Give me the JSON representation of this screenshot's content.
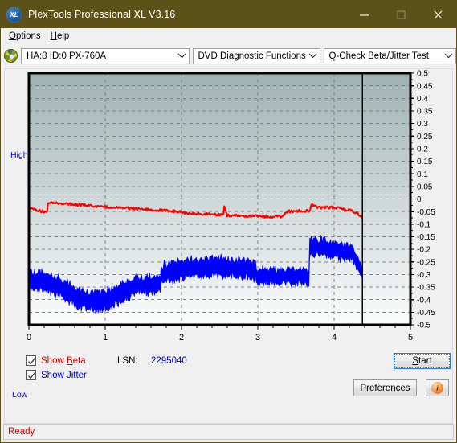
{
  "window": {
    "title": "PlexTools Professional XL V3.16",
    "icon": "xl-logo-icon",
    "logo_text": "XL",
    "minimize_label": "─",
    "maximize_label": "□",
    "close_label": "✕",
    "titlebar_color": "#5c5118"
  },
  "menubar": {
    "items": [
      {
        "label": "Options",
        "accel": "O"
      },
      {
        "label": "Help",
        "accel": "H"
      }
    ]
  },
  "toolbar": {
    "disc_icon": "disc-icon",
    "drive_select": {
      "value": "HA:8 ID:0  PX-760A",
      "options": [
        "HA:8 ID:0  PX-760A"
      ]
    },
    "function_select": {
      "value": "DVD Diagnostic Functions",
      "options": [
        "DVD Diagnostic Functions"
      ]
    },
    "test_select": {
      "value": "Q-Check Beta/Jitter Test",
      "options": [
        "Q-Check Beta/Jitter Test"
      ]
    }
  },
  "chart_labels": {
    "high": "High",
    "low": "Low"
  },
  "controls": {
    "show_beta": {
      "label": "Show Beta",
      "accel": "B",
      "checked": true,
      "color": "#d00000"
    },
    "show_jitter": {
      "label": "Show Jitter",
      "accel": "J",
      "checked": true,
      "color": "#0000d0"
    },
    "lsn_label": "LSN:",
    "lsn_value": "2295040",
    "start_button": {
      "label": "Start",
      "accel": "S",
      "focused": true
    },
    "preferences_button": {
      "label": "Preferences",
      "accel": "P"
    },
    "info_button": {
      "label": "i",
      "icon": "info-icon"
    }
  },
  "statusbar": {
    "text": "Ready",
    "color": "#d00000"
  },
  "chart_data": {
    "type": "line",
    "title": "Q-Check Beta/Jitter Test",
    "xlabel": "",
    "ylabel": "",
    "xlim": [
      0,
      5
    ],
    "ylim": [
      -0.5,
      0.5
    ],
    "xticks": [
      0,
      1,
      2,
      3,
      4,
      5
    ],
    "yticks": [
      0.5,
      0.45,
      0.4,
      0.35,
      0.3,
      0.25,
      0.2,
      0.15,
      0.1,
      0.05,
      0,
      -0.05,
      -0.1,
      -0.15,
      -0.2,
      -0.25,
      -0.3,
      -0.35,
      -0.4,
      -0.45,
      -0.5
    ],
    "grid": true,
    "grid_style": "dashed",
    "grid_color": "#808080",
    "plot_bg_gradient": [
      "#9fb2b3",
      "#fbfcfc"
    ],
    "legend_position": "below-left",
    "data_end_marker_x": 4.37,
    "series": [
      {
        "name": "Beta",
        "color": "#ff0000",
        "label": "Show Beta",
        "x": [
          0.0,
          0.05,
          0.1,
          0.15,
          0.2,
          0.24,
          0.25,
          0.3,
          0.4,
          0.5,
          0.6,
          0.7,
          0.8,
          0.9,
          1.0,
          1.1,
          1.2,
          1.3,
          1.4,
          1.5,
          1.6,
          1.7,
          1.8,
          1.9,
          1.99,
          2.0,
          2.1,
          2.2,
          2.3,
          2.4,
          2.5,
          2.55,
          2.56,
          2.6,
          2.7,
          2.8,
          2.9,
          2.99,
          3.0,
          3.1,
          3.2,
          3.3,
          3.4,
          3.5,
          3.6,
          3.68,
          3.7,
          3.8,
          3.9,
          4.0,
          4.1,
          4.2,
          4.3,
          4.37
        ],
        "y": [
          -0.035,
          -0.04,
          -0.045,
          -0.048,
          -0.05,
          -0.052,
          -0.012,
          -0.014,
          -0.017,
          -0.02,
          -0.022,
          -0.025,
          -0.027,
          -0.029,
          -0.031,
          -0.033,
          -0.035,
          -0.037,
          -0.039,
          -0.041,
          -0.043,
          -0.045,
          -0.047,
          -0.049,
          -0.05,
          -0.056,
          -0.058,
          -0.059,
          -0.06,
          -0.061,
          -0.062,
          -0.062,
          -0.03,
          -0.065,
          -0.066,
          -0.067,
          -0.068,
          -0.068,
          -0.069,
          -0.07,
          -0.07,
          -0.071,
          -0.05,
          -0.048,
          -0.047,
          -0.046,
          -0.022,
          -0.035,
          -0.033,
          -0.034,
          -0.038,
          -0.045,
          -0.055,
          -0.072
        ]
      },
      {
        "name": "Jitter",
        "color": "#0000ff",
        "label": "Show Jitter",
        "segments": [
          {
            "x_start": 0.0,
            "x_end": 1.34,
            "center_start": -0.355,
            "center_end": -0.35,
            "band": 0.045,
            "note": "noisy low band with dip near 0.9 and rise near 1.15"
          },
          {
            "x_start": 1.35,
            "x_end": 1.72,
            "center_start": -0.345,
            "center_end": -0.34,
            "band": 0.04
          },
          {
            "x_start": 1.73,
            "x_end": 2.97,
            "center_start": -0.3,
            "center_end": -0.285,
            "band": 0.045
          },
          {
            "x_start": 2.98,
            "x_end": 3.67,
            "center_start": -0.305,
            "center_end": -0.31,
            "band": 0.038
          },
          {
            "x_start": 3.68,
            "x_end": 4.25,
            "center_start": -0.185,
            "center_end": -0.215,
            "band": 0.04
          },
          {
            "x_start": 4.26,
            "x_end": 4.37,
            "center_start": -0.23,
            "center_end": -0.285,
            "band": 0.03
          }
        ]
      }
    ]
  }
}
